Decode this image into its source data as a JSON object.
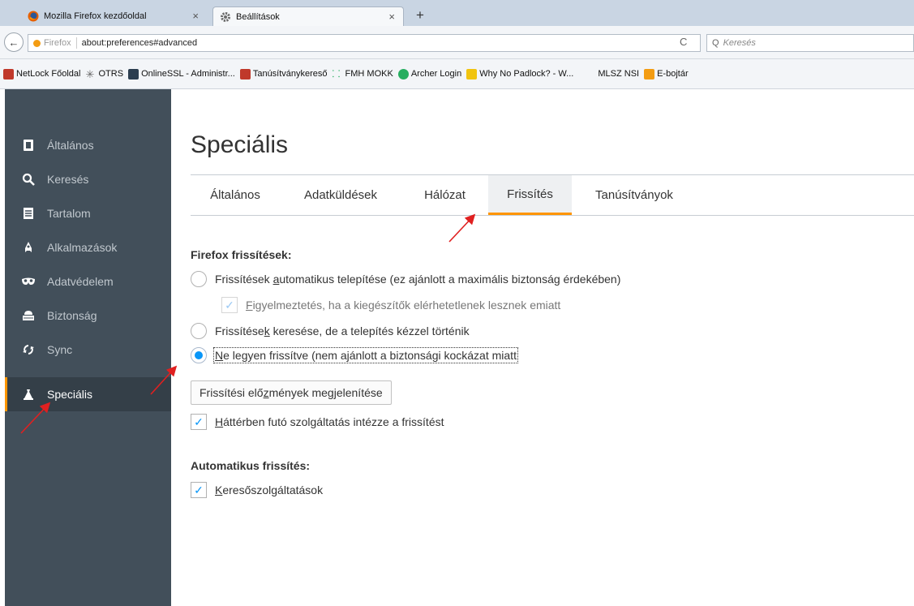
{
  "tabs": [
    {
      "label": "Mozilla Firefox kezdőoldal",
      "close": "×"
    },
    {
      "label": "Beállítások",
      "close": "×"
    }
  ],
  "new_tab": "+",
  "nav": {
    "back": "←",
    "site_label": "Firefox",
    "url": "about:preferences#advanced",
    "reload": "C",
    "search_placeholder": "Keresés",
    "search_icon": "Q"
  },
  "bookmarks": [
    {
      "label": "NetLock Főoldal",
      "color": "#c0392b"
    },
    {
      "label": "OTRS",
      "color": "#888888"
    },
    {
      "label": "OnlineSSL - Administr...",
      "color": "#2c3e50"
    },
    {
      "label": "Tanúsítványkereső",
      "color": "#c0392b"
    },
    {
      "label": "FMH MOKK",
      "color": "#27ae60"
    },
    {
      "label": "Archer Login",
      "color": "#27ae60"
    },
    {
      "label": "Why No Padlock? - W...",
      "color": "#f1c40f"
    },
    {
      "label": "MLSZ NSI",
      "color": "#ffffff"
    },
    {
      "label": "E-bojtár",
      "color": "#f39c12"
    }
  ],
  "sidebar": {
    "items": [
      {
        "label": "Általános",
        "icon": "general-icon"
      },
      {
        "label": "Keresés",
        "icon": "search-icon"
      },
      {
        "label": "Tartalom",
        "icon": "content-icon"
      },
      {
        "label": "Alkalmazások",
        "icon": "applications-icon"
      },
      {
        "label": "Adatvédelem",
        "icon": "privacy-mask-icon"
      },
      {
        "label": "Biztonság",
        "icon": "security-icon"
      },
      {
        "label": "Sync",
        "icon": "sync-icon"
      },
      {
        "label": "Speciális",
        "icon": "advanced-icon"
      }
    ],
    "selected_index": 7
  },
  "main": {
    "title": "Speciális",
    "subtabs": [
      "Általános",
      "Adatküldések",
      "Hálózat",
      "Frissítés",
      "Tanúsítványok"
    ],
    "selected_subtab": "Frissítés",
    "firefox_updates_heading": "Firefox frissítések:",
    "opt_auto": {
      "pre": "Frissítések ",
      "key": "a",
      "post": "utomatikus telepítése (ez ajánlott a maximális biztonság érdekében)"
    },
    "opt_warn": {
      "pre": "",
      "key": "F",
      "post": "igyelmeztetés, ha a kiegészítők elérhetetlenek lesznek emiatt"
    },
    "opt_check": {
      "pre": "Frissítése",
      "key": "k",
      "post": " keresése, de a telepítés kézzel történik"
    },
    "opt_never": {
      "pre": "",
      "key": "N",
      "post": "e legyen frissítve (nem ajánlott a biztonsági kockázat miatt"
    },
    "history_button": {
      "pre": "Frissítési elő",
      "key": "z",
      "post": "mények megjelenítése"
    },
    "opt_background": {
      "pre": "",
      "key": "H",
      "post": "áttérben futó szolgáltatás intézze a frissítést"
    },
    "auto_updates_heading": "Automatikus frissítés:",
    "opt_search_engines": {
      "pre": "",
      "key": "K",
      "post": "eresőszolgáltatások"
    },
    "check_mark": "✓"
  },
  "colors": {
    "accent": "#ff9500",
    "radio_blue": "#0996f8",
    "sidebar_bg": "#424f5a",
    "annotation_arrow": "#e02020"
  }
}
